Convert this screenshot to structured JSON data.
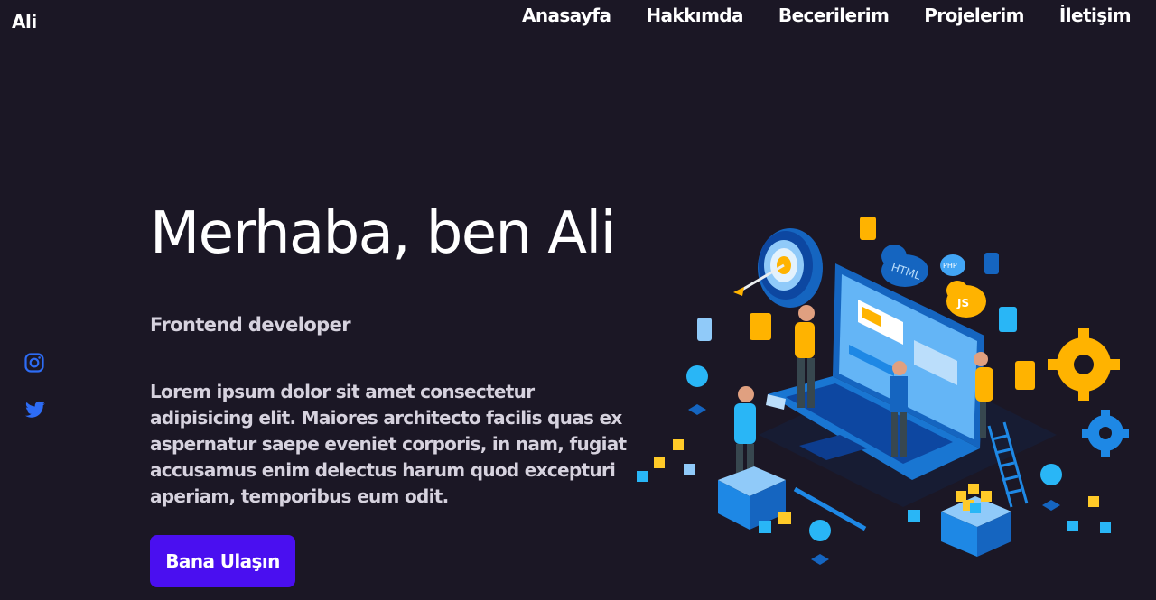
{
  "header": {
    "logo": "Ali",
    "nav": [
      "Anasayfa",
      "Hakkımda",
      "Becerilerim",
      "Projelerim",
      "İletişim"
    ]
  },
  "social": {
    "icons": [
      "instagram-icon",
      "twitter-icon"
    ],
    "accent": "#2d6cf5"
  },
  "hero": {
    "title": "Merhaba, ben Ali",
    "subtitle": "Frontend developer",
    "description": "Lorem ipsum dolor sit amet consectetur adipisicing elit. Maiores architecto facilis quas ex aspernatur saepe eveniet corporis, in nam, fugiat accusamus enim delectus harum quod excepturi aperiam, temporibus eum odit.",
    "button": "Bana Ulaşın",
    "illustration": {
      "labels": [
        "HTML",
        "PHP",
        "JS"
      ]
    }
  },
  "colors": {
    "background": "#1b1725",
    "button": "#4a0ff0",
    "text_muted": "#d6d2de"
  }
}
